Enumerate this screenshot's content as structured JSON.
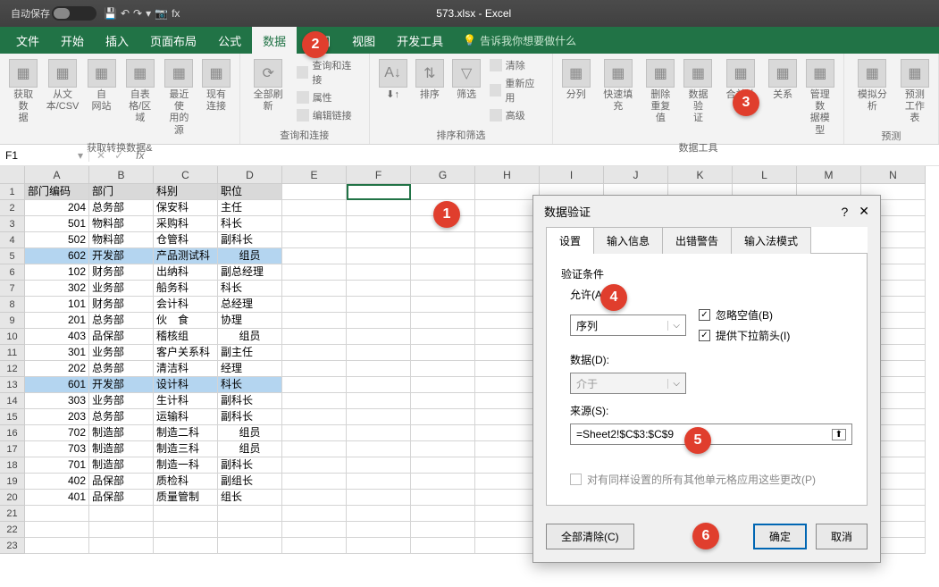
{
  "titlebar": {
    "autosave": "自动保存",
    "title": "573.xlsx - Excel"
  },
  "tabs": [
    "文件",
    "开始",
    "插入",
    "页面布局",
    "公式",
    "数据",
    "审阅",
    "视图",
    "开发工具"
  ],
  "active_tab": 5,
  "tell_me": "告诉我你想要做什么",
  "ribbon": {
    "g1": {
      "label": "获取转换数据&",
      "btns": [
        "获取数\n据",
        "从文\n本/CSV",
        "自\n网站",
        "自表\n格/区域",
        "最近使\n用的源",
        "现有\n连接"
      ]
    },
    "g2": {
      "label": "查询和连接",
      "btn": "全部刷新",
      "small": [
        "查询和连接",
        "属性",
        "编辑链接"
      ]
    },
    "g3": {
      "label": "排序和筛选",
      "btns": [
        "⬇↑",
        "排序",
        "筛选"
      ],
      "small": [
        "清除",
        "重新应用",
        "高级"
      ]
    },
    "g4": {
      "label": "数据工具",
      "btns": [
        "分列",
        "快速填充",
        "删除\n重复值",
        "数据验\n证",
        "合并计算",
        "关系",
        "管理数\n据模型"
      ]
    },
    "g5": {
      "label": "预测",
      "btns": [
        "模拟分析",
        "预测\n工作表"
      ]
    }
  },
  "namebox": "F1",
  "columns": [
    "A",
    "B",
    "C",
    "D",
    "E",
    "F",
    "G",
    "H",
    "I",
    "J",
    "K",
    "L",
    "M",
    "N"
  ],
  "headers": [
    "部门编码",
    "部门",
    "科别",
    "职位"
  ],
  "rows": [
    {
      "a": "204",
      "b": "总务部",
      "c": "保安科",
      "d": "主任"
    },
    {
      "a": "501",
      "b": "物料部",
      "c": "采购科",
      "d": "科长"
    },
    {
      "a": "502",
      "b": "物料部",
      "c": "仓管科",
      "d": "副科长"
    },
    {
      "a": "602",
      "b": "开发部",
      "c": "产品测试科",
      "d": "组员",
      "hl": true
    },
    {
      "a": "102",
      "b": "财务部",
      "c": "出纳科",
      "d": "副总经理"
    },
    {
      "a": "302",
      "b": "业务部",
      "c": "船务科",
      "d": "科长"
    },
    {
      "a": "101",
      "b": "财务部",
      "c": "会计科",
      "d": "总经理"
    },
    {
      "a": "201",
      "b": "总务部",
      "c": "伙　食",
      "d": "协理"
    },
    {
      "a": "403",
      "b": "品保部",
      "c": "稽核组",
      "d": "组员"
    },
    {
      "a": "301",
      "b": "业务部",
      "c": "客户关系科",
      "d": "副主任"
    },
    {
      "a": "202",
      "b": "总务部",
      "c": "清洁科",
      "d": "经理"
    },
    {
      "a": "601",
      "b": "开发部",
      "c": "设计科",
      "d": "科长",
      "hl": true
    },
    {
      "a": "303",
      "b": "业务部",
      "c": "生计科",
      "d": "副科长"
    },
    {
      "a": "203",
      "b": "总务部",
      "c": "运输科",
      "d": "副科长"
    },
    {
      "a": "702",
      "b": "制造部",
      "c": "制造二科",
      "d": "组员",
      "ctr": true
    },
    {
      "a": "703",
      "b": "制造部",
      "c": "制造三科",
      "d": "组员",
      "ctr": true
    },
    {
      "a": "701",
      "b": "制造部",
      "c": "制造一科",
      "d": "副科长"
    },
    {
      "a": "402",
      "b": "品保部",
      "c": "质检科",
      "d": "副组长"
    },
    {
      "a": "401",
      "b": "品保部",
      "c": "质量管制",
      "d": "组长"
    }
  ],
  "dialog": {
    "title": "数据验证",
    "tabs": [
      "设置",
      "输入信息",
      "出错警告",
      "输入法模式"
    ],
    "section": "验证条件",
    "allow_label": "允许(A):",
    "allow_value": "序列",
    "ignore_blank": "忽略空值(B)",
    "dropdown_arrow": "提供下拉箭头(I)",
    "data_label": "数据(D):",
    "data_value": "介于",
    "source_label": "来源(S):",
    "source_value": "=Sheet2!$C$3:$C$9",
    "apply_all": "对有同样设置的所有其他单元格应用这些更改(P)",
    "clear": "全部清除(C)",
    "ok": "确定",
    "cancel": "取消"
  },
  "callouts": {
    "1": "1",
    "2": "2",
    "3": "3",
    "4": "4",
    "5": "5",
    "6": "6"
  }
}
